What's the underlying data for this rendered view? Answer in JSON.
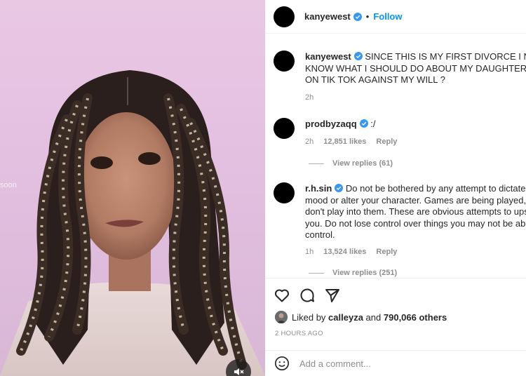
{
  "media": {
    "wall_text": "soon"
  },
  "header": {
    "username": "kanyewest",
    "separator": "•",
    "follow_label": "Follow"
  },
  "comments": [
    {
      "username": "kanyewest",
      "lines": [
        "SINCE THIS IS MY FIRST DIVORCE I NEED TO",
        "KNOW WHAT I SHOULD DO ABOUT MY DAUGHTER BEING",
        "ON TIK TOK AGAINST MY WILL ?"
      ],
      "time": "2h"
    },
    {
      "username": "prodbyzaqq",
      "lines": [
        ":/"
      ],
      "time": "2h",
      "likes": "12,851 likes",
      "reply": "Reply",
      "view_replies": "View replies (61)"
    },
    {
      "username": "r.h.sin",
      "lines": [
        "Do not be bothered by any attempt to dictate your",
        "mood or alter your character. Games are being played, so",
        "don't play into them. These are obvious attempts to upset",
        "you. Do not lose control over things you may not be able to",
        "control."
      ],
      "time": "1h",
      "likes": "13,524 likes",
      "reply": "Reply",
      "view_replies": "View replies (251)"
    }
  ],
  "liked_by": {
    "prefix": "Liked by",
    "user": "calleyza",
    "and": "and",
    "others": "790,066 others"
  },
  "timestamp": "2 HOURS AGO",
  "add_comment": {
    "placeholder": "Add a comment..."
  },
  "icons": {
    "like": "heart-icon",
    "comment": "comment-bubble-icon",
    "share": "paper-plane-icon",
    "mute": "speaker-muted-icon",
    "emoji": "emoji-smile-icon",
    "verified": "verified-badge-icon"
  },
  "colors": {
    "accent": "#0095f6",
    "muted": "#8e8e8e",
    "text": "#262626"
  }
}
